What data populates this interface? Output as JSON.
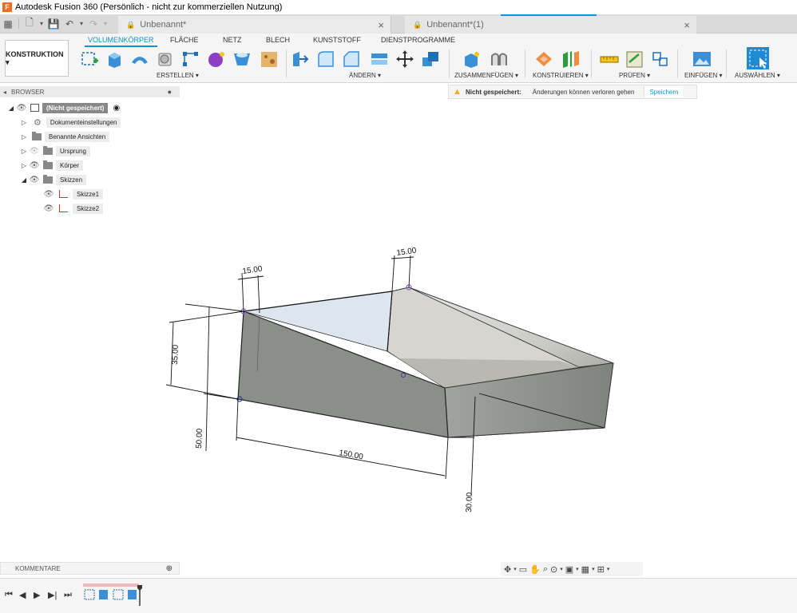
{
  "titlebar": {
    "icon_letter": "F",
    "title": "Autodesk Fusion 360 (Persönlich - nicht zur kommerziellen Nutzung)"
  },
  "tabs": [
    {
      "label": "Unbenannt*"
    },
    {
      "label": "Unbenannt*(1)"
    }
  ],
  "toolbar": {
    "workspace": "KONSTRUKTION ▾",
    "tabs": [
      "VOLUMENKÖRPER",
      "FLÄCHE",
      "NETZ",
      "BLECH",
      "KUNSTSTOFF",
      "DIENSTPROGRAMME"
    ],
    "groups": [
      "ERSTELLEN ▾",
      "ÄNDERN ▾",
      "ZUSAMMENFÜGEN ▾",
      "KONSTRUIEREN ▾",
      "PRÜFEN ▾",
      "EINFÜGEN ▾",
      "AUSWÄHLEN ▾"
    ]
  },
  "browser": {
    "header": "BROWSER",
    "root": "(Nicht gespeichert)",
    "items": [
      {
        "label": "Dokumenteinstellungen",
        "icon": "gear-icon"
      },
      {
        "label": "Benannte Ansichten",
        "icon": "folder-icon"
      },
      {
        "label": "Ursprung",
        "icon": "folder-icon"
      },
      {
        "label": "Körper",
        "icon": "folder-icon"
      },
      {
        "label": "Skizzen",
        "icon": "folder-icon"
      },
      {
        "label": "Skizze1",
        "icon": "sketch-icon"
      },
      {
        "label": "Skizze2",
        "icon": "sketch-icon"
      }
    ]
  },
  "warning": {
    "title": "Nicht gespeichert:",
    "message": "Änderungen können verloren gehen",
    "action": "Speichern"
  },
  "dimensions": [
    "15.00",
    "15.00",
    "35.00",
    "50.00",
    "150.00",
    "30.00"
  ],
  "comments": {
    "label": "KOMMENTARE",
    "add_icon": "plus-icon"
  },
  "colors": {
    "accent": "#0696d7",
    "body_face": "#8a8f8a",
    "body_top": "#bfbeb8",
    "warning": "#f5a623"
  }
}
